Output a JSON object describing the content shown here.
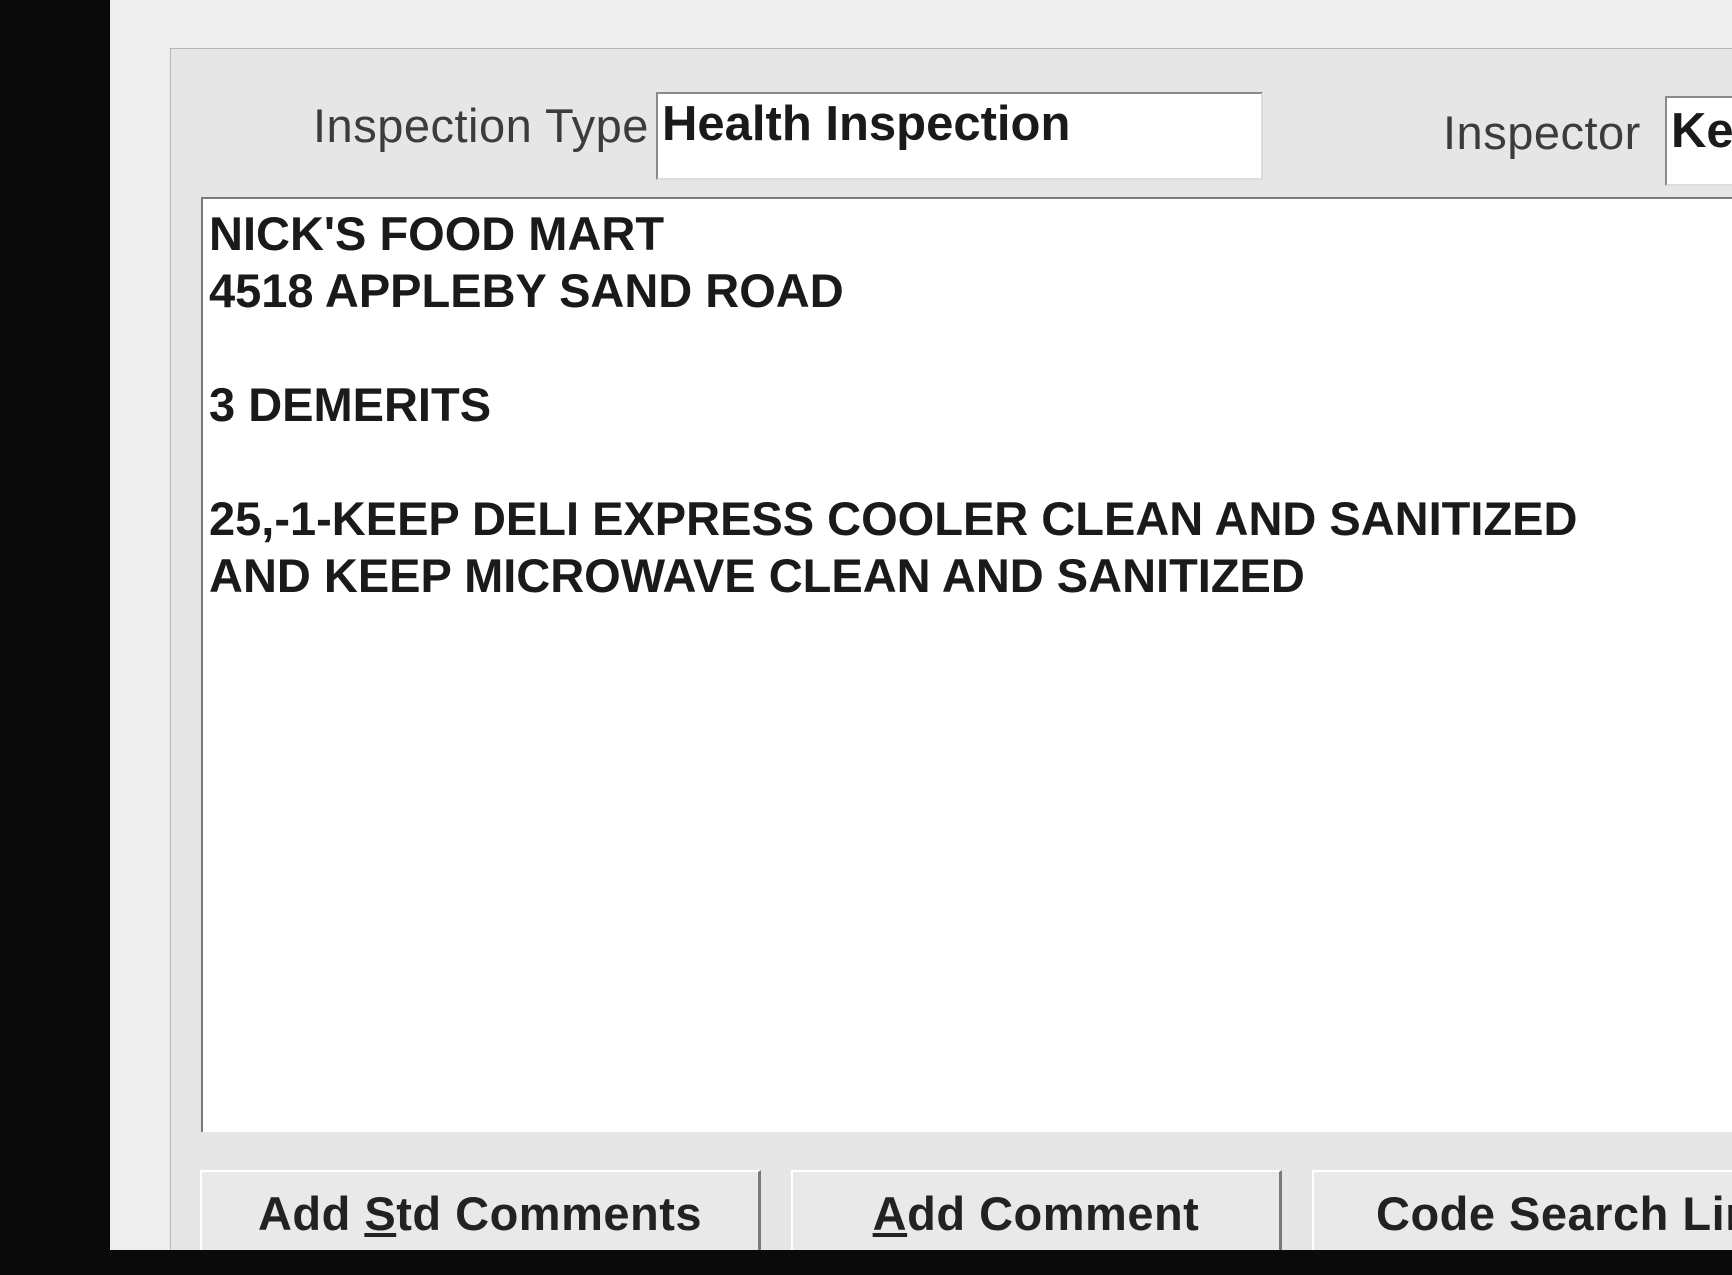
{
  "fields": {
    "inspection_type": {
      "label": "Inspection Type",
      "value": "Health Inspection"
    },
    "inspector": {
      "label": "Inspector",
      "value": "Ke"
    }
  },
  "comments": {
    "lines": [
      "NICK'S FOOD MART",
      "4518 APPLEBY SAND ROAD",
      "",
      "3 DEMERITS",
      "",
      "25,-1-KEEP DELI EXPRESS COOLER CLEAN AND SANITIZED",
      "AND KEEP MICROWAVE CLEAN AND SANITIZED"
    ]
  },
  "buttons": {
    "add_std_comments": {
      "pre": "Add ",
      "mnemonic": "S",
      "post": "td Comments"
    },
    "add_comment": {
      "pre": "",
      "mnemonic": "A",
      "post": "dd Comment"
    },
    "code_search": {
      "pre": "Code Search Lin",
      "mnemonic": "",
      "post": ""
    }
  }
}
